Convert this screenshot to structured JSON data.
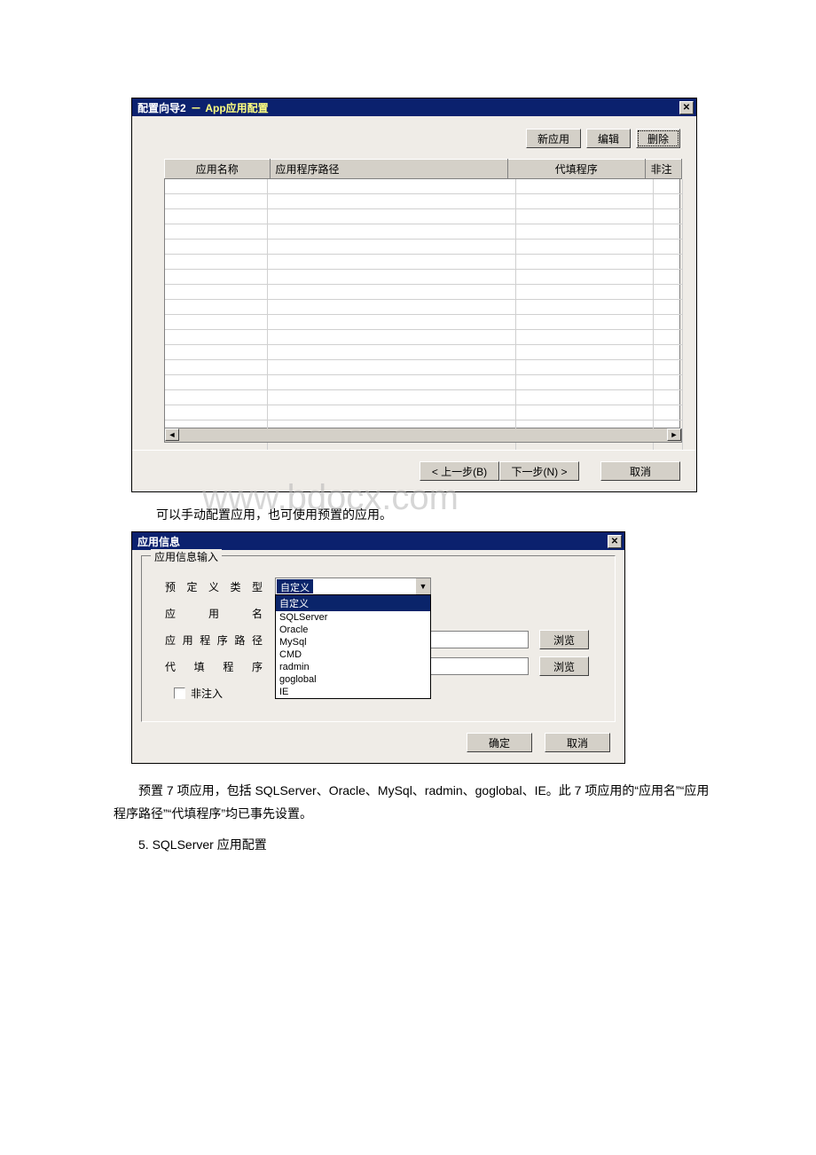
{
  "wizard": {
    "title_main": "配置向导2",
    "title_sub": "App应用配置",
    "buttons": {
      "new": "新应用",
      "edit": "编辑",
      "delete": "删除"
    },
    "columns": {
      "c1": "应用名称",
      "c2": "应用程序路径",
      "c3": "代填程序",
      "c4": "非注"
    },
    "footer": {
      "prev": "< 上一步(B)",
      "next": "下一步(N) >",
      "cancel": "取消"
    }
  },
  "mid_text": "可以手动配置应用，也可使用预置的应用。",
  "watermark": "www.bdocx.com",
  "appinfo": {
    "title": "应用信息",
    "group_legend": "应用信息输入",
    "labels": {
      "predef": "预定义类型",
      "appname": "应用名",
      "apppath": "应用程序路径",
      "filler": "代填程序",
      "noinject": "非注入"
    },
    "combo_selected": "自定义",
    "options": [
      "自定义",
      "SQLServer",
      "Oracle",
      "MySql",
      "CMD",
      "radmin",
      "goglobal",
      "IE"
    ],
    "browse": "浏览",
    "ok": "确定",
    "cancel": "取消"
  },
  "para": "预置 7 项应用，包括 SQLServer、Oracle、MySql、radmin、goglobal、IE。此 7 项应用的“应用名”“应用程序路径”“代填程序”均已事先设置。",
  "heading": "5. SQLServer 应用配置"
}
